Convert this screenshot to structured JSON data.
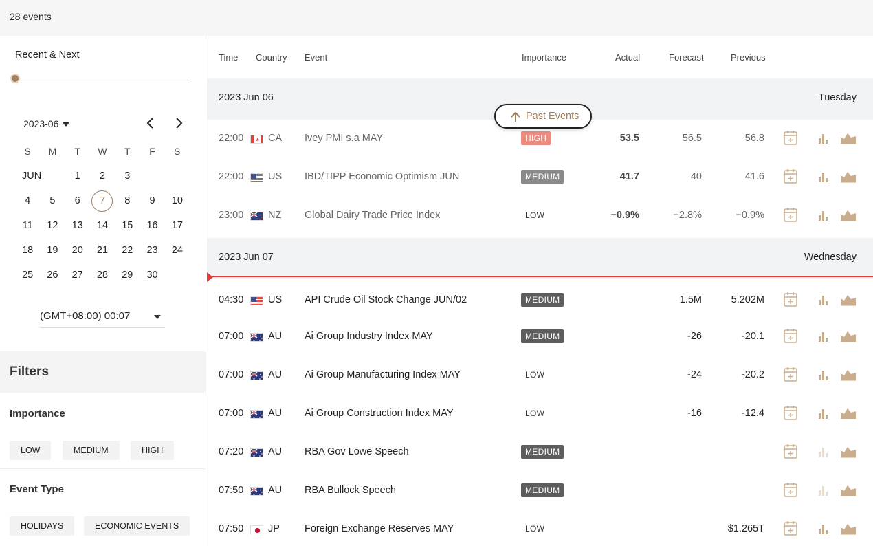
{
  "header": {
    "event_count": "28 events"
  },
  "sidebar": {
    "range_label": "Recent & Next",
    "month_selector": "2023-06",
    "weekdays": [
      "S",
      "M",
      "T",
      "W",
      "T",
      "F",
      "S"
    ],
    "month_label": "JUN",
    "weeks": [
      [
        "",
        "",
        "",
        "",
        "1",
        "2",
        "3"
      ],
      [
        "4",
        "5",
        "6",
        "7",
        "8",
        "9",
        "10"
      ],
      [
        "11",
        "12",
        "13",
        "14",
        "15",
        "16",
        "17"
      ],
      [
        "18",
        "19",
        "20",
        "21",
        "22",
        "23",
        "24"
      ],
      [
        "25",
        "26",
        "27",
        "28",
        "29",
        "30",
        ""
      ]
    ],
    "today": "7",
    "timezone": "(GMT+08:00) 00:07",
    "filters_title": "Filters",
    "importance_label": "Importance",
    "importance_chips": [
      "LOW",
      "MEDIUM",
      "HIGH"
    ],
    "event_type_label": "Event Type",
    "event_type_chips": [
      "HOLIDAYS",
      "ECONOMIC EVENTS"
    ]
  },
  "table": {
    "columns": {
      "time": "Time",
      "country": "Country",
      "event": "Event",
      "importance": "Importance",
      "actual": "Actual",
      "forecast": "Forecast",
      "previous": "Previous"
    },
    "past_events_button": "Past Events",
    "days": [
      {
        "date": "2023 Jun 06",
        "weekday": "Tuesday",
        "events": [
          {
            "time": "22:00",
            "country": "CA",
            "event": "Ivey PMI s.a MAY",
            "importance": "HIGH",
            "actual": "53.5",
            "forecast": "56.5",
            "previous": "56.8",
            "chart_active": true
          },
          {
            "time": "22:00",
            "country": "US",
            "event": "IBD/TIPP Economic Optimism JUN",
            "importance": "MEDIUM",
            "actual": "41.7",
            "forecast": "40",
            "previous": "41.6",
            "chart_active": true
          },
          {
            "time": "23:00",
            "country": "NZ",
            "event": "Global Dairy Trade Price Index",
            "importance": "LOW",
            "actual": "−0.9%",
            "forecast": "−2.8%",
            "previous": "−0.9%",
            "chart_active": true
          }
        ]
      },
      {
        "date": "2023 Jun 07",
        "weekday": "Wednesday",
        "events": [
          {
            "time": "04:30",
            "country": "US",
            "event": "API Crude Oil Stock Change JUN/02",
            "importance": "MEDIUM",
            "actual": "",
            "forecast": "1.5M",
            "previous": "5.202M",
            "chart_active": true
          },
          {
            "time": "07:00",
            "country": "AU",
            "event": "Ai Group Industry Index MAY",
            "importance": "MEDIUM",
            "actual": "",
            "forecast": "-26",
            "previous": "-20.1",
            "chart_active": true
          },
          {
            "time": "07:00",
            "country": "AU",
            "event": "Ai Group Manufacturing Index MAY",
            "importance": "LOW",
            "actual": "",
            "forecast": "-24",
            "previous": "-20.2",
            "chart_active": true
          },
          {
            "time": "07:00",
            "country": "AU",
            "event": "Ai Group Construction Index MAY",
            "importance": "LOW",
            "actual": "",
            "forecast": "-16",
            "previous": "-12.4",
            "chart_active": true
          },
          {
            "time": "07:20",
            "country": "AU",
            "event": "RBA Gov Lowe Speech",
            "importance": "MEDIUM",
            "actual": "",
            "forecast": "",
            "previous": "",
            "chart_active": false
          },
          {
            "time": "07:50",
            "country": "AU",
            "event": "RBA Bullock Speech",
            "importance": "MEDIUM",
            "actual": "",
            "forecast": "",
            "previous": "",
            "chart_active": false
          },
          {
            "time": "07:50",
            "country": "JP",
            "event": "Foreign Exchange Reserves MAY",
            "importance": "LOW",
            "actual": "",
            "forecast": "",
            "previous": "$1.265T",
            "chart_active": true
          }
        ]
      }
    ]
  },
  "colors": {
    "accent": "#a08060",
    "high": "#e8776b",
    "medium": "#5d5d5d",
    "now_line": "#e53935",
    "icon": "#c9ad8c"
  },
  "icons": {
    "calendar_add": "calendar-plus-icon",
    "bar_chart": "bar-chart-icon",
    "area_chart": "area-chart-icon",
    "prev": "chevron-left-icon",
    "next": "chevron-right-icon",
    "up": "arrow-up-icon"
  }
}
